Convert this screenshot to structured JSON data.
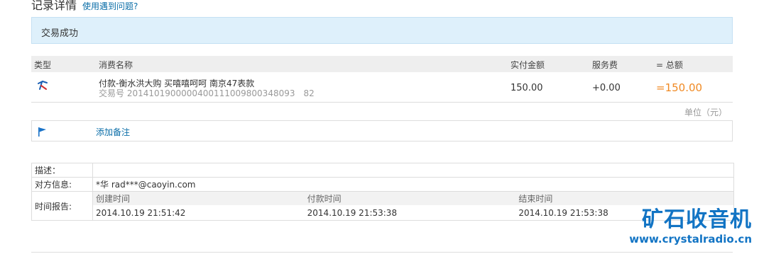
{
  "header": {
    "title": "记录详情",
    "help_link": "使用遇到问题?"
  },
  "status": {
    "text": "交易成功"
  },
  "table": {
    "columns": {
      "type": "类型",
      "name": "消费名称",
      "paid": "实付金额",
      "fee": "服务费",
      "total": "= 总额"
    },
    "row": {
      "name": "付款-衡水洪大购 买嘻嘻呵呵 南京47表款",
      "txn": "交易号 2014101900000400111009800348093 82",
      "paid": "150.00",
      "fee": "+0.00",
      "total": "=150.00"
    }
  },
  "unit": "单位（元）",
  "memo": {
    "label": "添加备注"
  },
  "info": {
    "desc_label": "描述：",
    "desc_value": "",
    "party_label": "对方信息:",
    "party_value": "*华 rad***@caoyin.com",
    "time_label": "时间报告:",
    "time_headers": [
      "创建时间",
      "付款时间",
      "结束时间"
    ],
    "time_values": [
      "2014.10.19 21:51:42",
      "2014.10.19 21:53:38",
      "2014.10.19 21:53:38"
    ]
  },
  "watermark": {
    "cn": "矿石收音机",
    "url": "www.crystalradio.cn"
  },
  "colors": {
    "accent": "#0b6ea8",
    "total": "#f08a24",
    "status_bg": "#def0fb",
    "watermark": "#1274c4"
  }
}
